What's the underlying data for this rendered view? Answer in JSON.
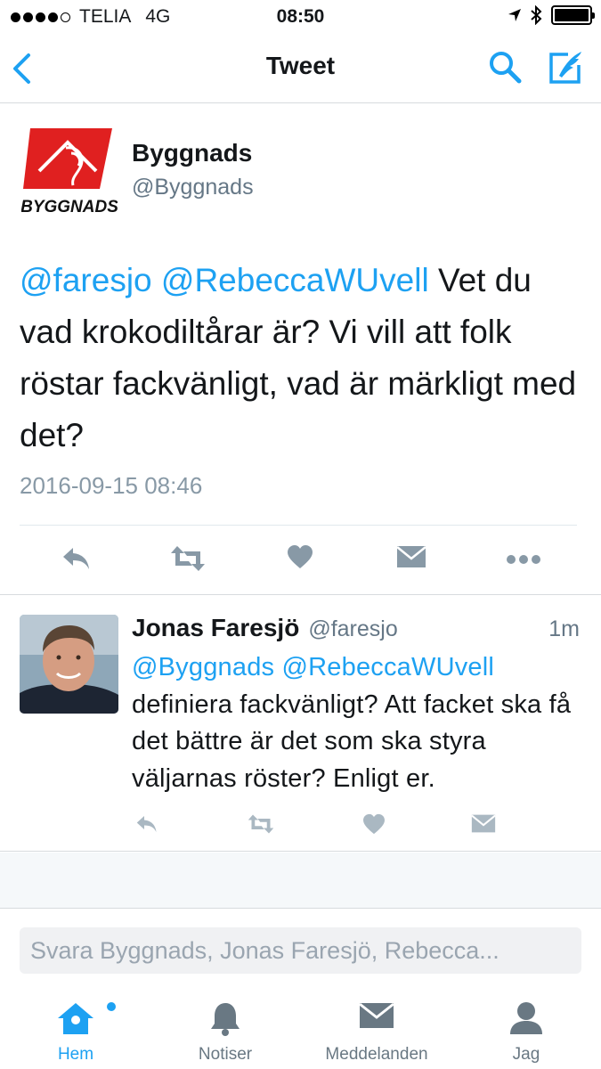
{
  "status_bar": {
    "carrier": "TELIA",
    "network": "4G",
    "time": "08:50"
  },
  "nav": {
    "title": "Tweet"
  },
  "main_tweet": {
    "logo_text": "BYGGNADS",
    "author_name": "Byggnads",
    "author_handle": "@Byggnads",
    "mention_1": "@faresjo",
    "mention_2": "@RebeccaWUvell",
    "text": "Vet du vad krokodiltårar är? Vi vill att folk röstar fackvänligt, vad är märkligt med det?",
    "date": "2016-09-15 08:46"
  },
  "reply": {
    "author_name": "Jonas Faresjö",
    "author_handle": "@faresjo",
    "time": "1m",
    "mention_1": "@Byggnads",
    "mention_2": "@RebeccaWUvell",
    "text": "definiera fackvänligt? Att facket ska få det bättre är det som ska styra väljarnas röster? Enligt er."
  },
  "compose": {
    "placeholder": "Svara Byggnads, Jonas Faresjö, Rebecca..."
  },
  "tabs": [
    {
      "label": "Hem",
      "icon": "home-icon",
      "active": true
    },
    {
      "label": "Notiser",
      "icon": "bell-icon",
      "active": false
    },
    {
      "label": "Meddelanden",
      "icon": "envelope-icon",
      "active": false
    },
    {
      "label": "Jag",
      "icon": "person-icon",
      "active": false
    }
  ],
  "colors": {
    "accent": "#1da1f2",
    "text": "#14171a",
    "secondary": "#657786",
    "icon_gray": "#8899a6",
    "logo_red": "#e02020"
  }
}
